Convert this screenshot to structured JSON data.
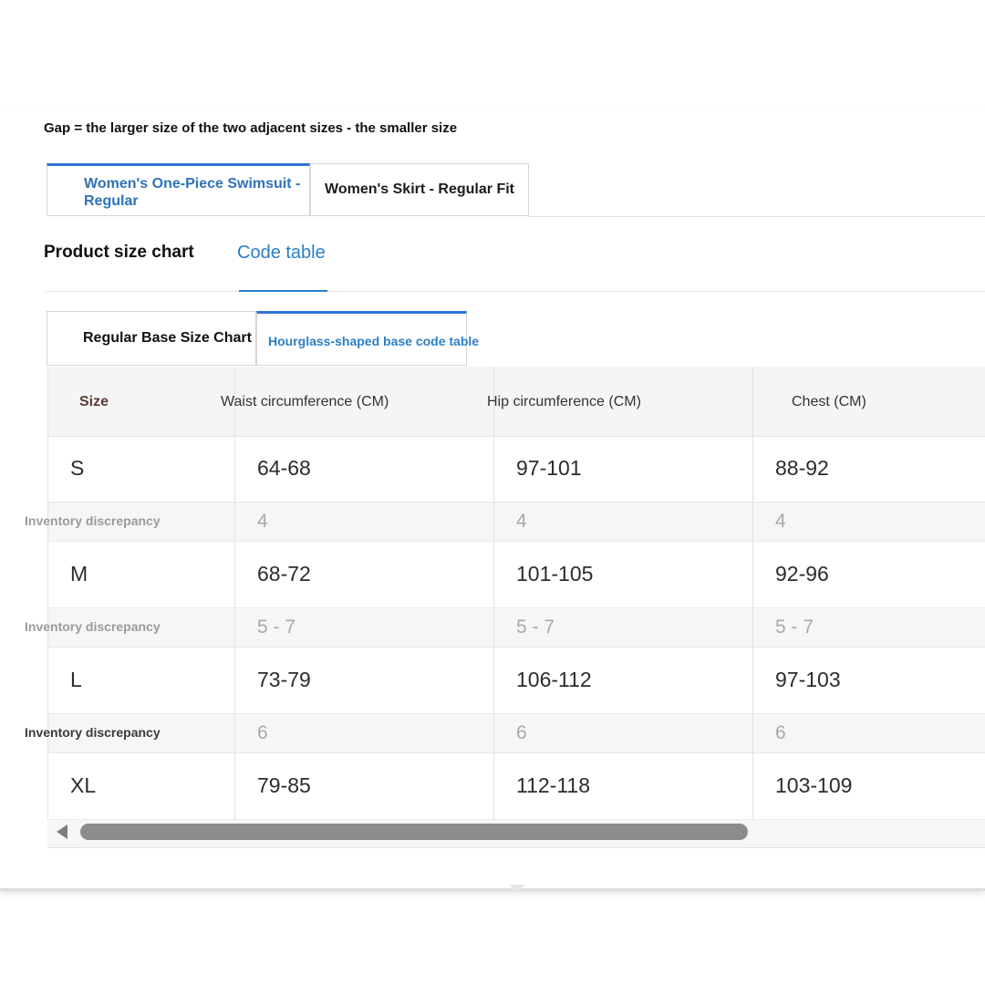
{
  "gap_note": "Gap = the larger size of the two adjacent sizes - the smaller size",
  "product_tabs": [
    {
      "label": "Women's One-Piece Swimsuit - Regular",
      "active": true
    },
    {
      "label": "Women's Skirt - Regular Fit",
      "active": false
    }
  ],
  "chart_tabs": [
    {
      "label": "Product size chart",
      "active": false
    },
    {
      "label": "Code table",
      "active": true
    }
  ],
  "base_tabs": [
    {
      "label": "Regular Base Size Chart",
      "active": false
    },
    {
      "label": "Hourglass-shaped base code table",
      "active": true
    }
  ],
  "table": {
    "headers": [
      "Size",
      "Waist circumference (CM)",
      "Hip circumference (CM)",
      "Chest (CM)"
    ],
    "rows": [
      {
        "size": "S",
        "waist": "64-68",
        "hip": "97-101",
        "chest": "88-92"
      },
      {
        "size": "M",
        "waist": "68-72",
        "hip": "101-105",
        "chest": "92-96"
      },
      {
        "size": "L",
        "waist": "73-79",
        "hip": "106-112",
        "chest": "97-103"
      },
      {
        "size": "XL",
        "waist": "79-85",
        "hip": "112-118",
        "chest": "103-109"
      }
    ],
    "gaps": [
      {
        "label": "Inventory discrepancy",
        "waist": "4",
        "hip": "4",
        "chest": "4"
      },
      {
        "label": "Inventory discrepancy",
        "waist": "5 - 7",
        "hip": "5 - 7",
        "chest": "5 - 7"
      },
      {
        "label": "Inventory discrepancy",
        "waist": "6",
        "hip": "6",
        "chest": "6"
      }
    ]
  },
  "colors": {
    "accent": "#2b7fc6",
    "tab_active_border": "#2e74d6",
    "text": "#222222",
    "muted": "#a9a9a9"
  },
  "icons": {
    "scroll_left": "triangle-left-icon"
  }
}
